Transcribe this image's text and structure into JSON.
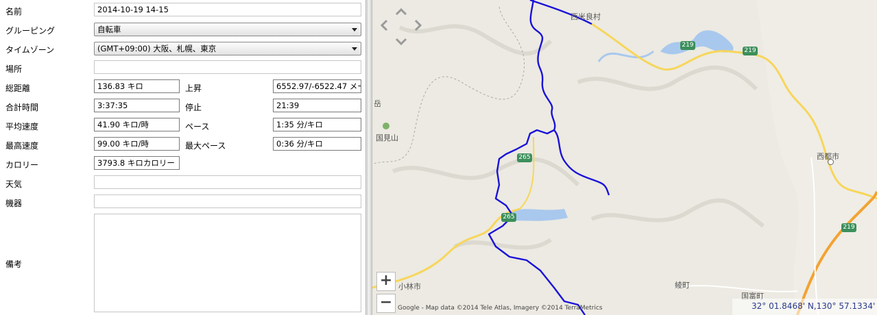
{
  "form": {
    "name_label": "名前",
    "name_value": "2014-10-19 14-15",
    "grouping_label": "グルーピング",
    "grouping_value": "自転車",
    "timezone_label": "タイムゾーン",
    "timezone_value": "(GMT+09:00) 大阪、札幌、東京",
    "location_label": "場所",
    "location_value": "",
    "distance_label": "総距離",
    "distance_value": "136.83 キロ",
    "ascent_label": "上昇",
    "ascent_value": "6552.97/-6522.47 メー",
    "total_time_label": "合計時間",
    "total_time_value": "3:37:35",
    "stop_label": "停止",
    "stop_value": "21:39",
    "avg_speed_label": "平均速度",
    "avg_speed_value": "41.90 キロ/時",
    "pace_label": "ペース",
    "pace_value": "1:35 分/キロ",
    "max_speed_label": "最高速度",
    "max_speed_value": "99.00 キロ/時",
    "max_pace_label": "最大ペース",
    "max_pace_value": "0:36 分/キロ",
    "calories_label": "カロリー",
    "calories_value": "3793.8 キロカロリー",
    "weather_label": "天気",
    "weather_value": "",
    "device_label": "機器",
    "device_value": "",
    "notes_label": "備考",
    "notes_value": ""
  },
  "map": {
    "zoom_in": "+",
    "zoom_out": "−",
    "attribution": "Google - Map data ©2014 Tele Atlas, Imagery ©2014 TerraMetrics",
    "coordinates": "32° 01.8468' N,130° 57.1334' E",
    "places": {
      "nishimera": "西米良村",
      "saito": "西都市",
      "kunimiyama": "国見山",
      "aya": "綾町",
      "kunitomi": "国富町",
      "kobayashi": "小林市",
      "dake": "岳"
    },
    "routes": {
      "r219a": "219",
      "r219b": "219",
      "r219c": "219",
      "r265a": "265",
      "r265b": "265"
    },
    "colors": {
      "track": "#1a12d8",
      "highway": "#f2a332",
      "road": "#f7d65a",
      "water": "#a9c8ee"
    }
  }
}
